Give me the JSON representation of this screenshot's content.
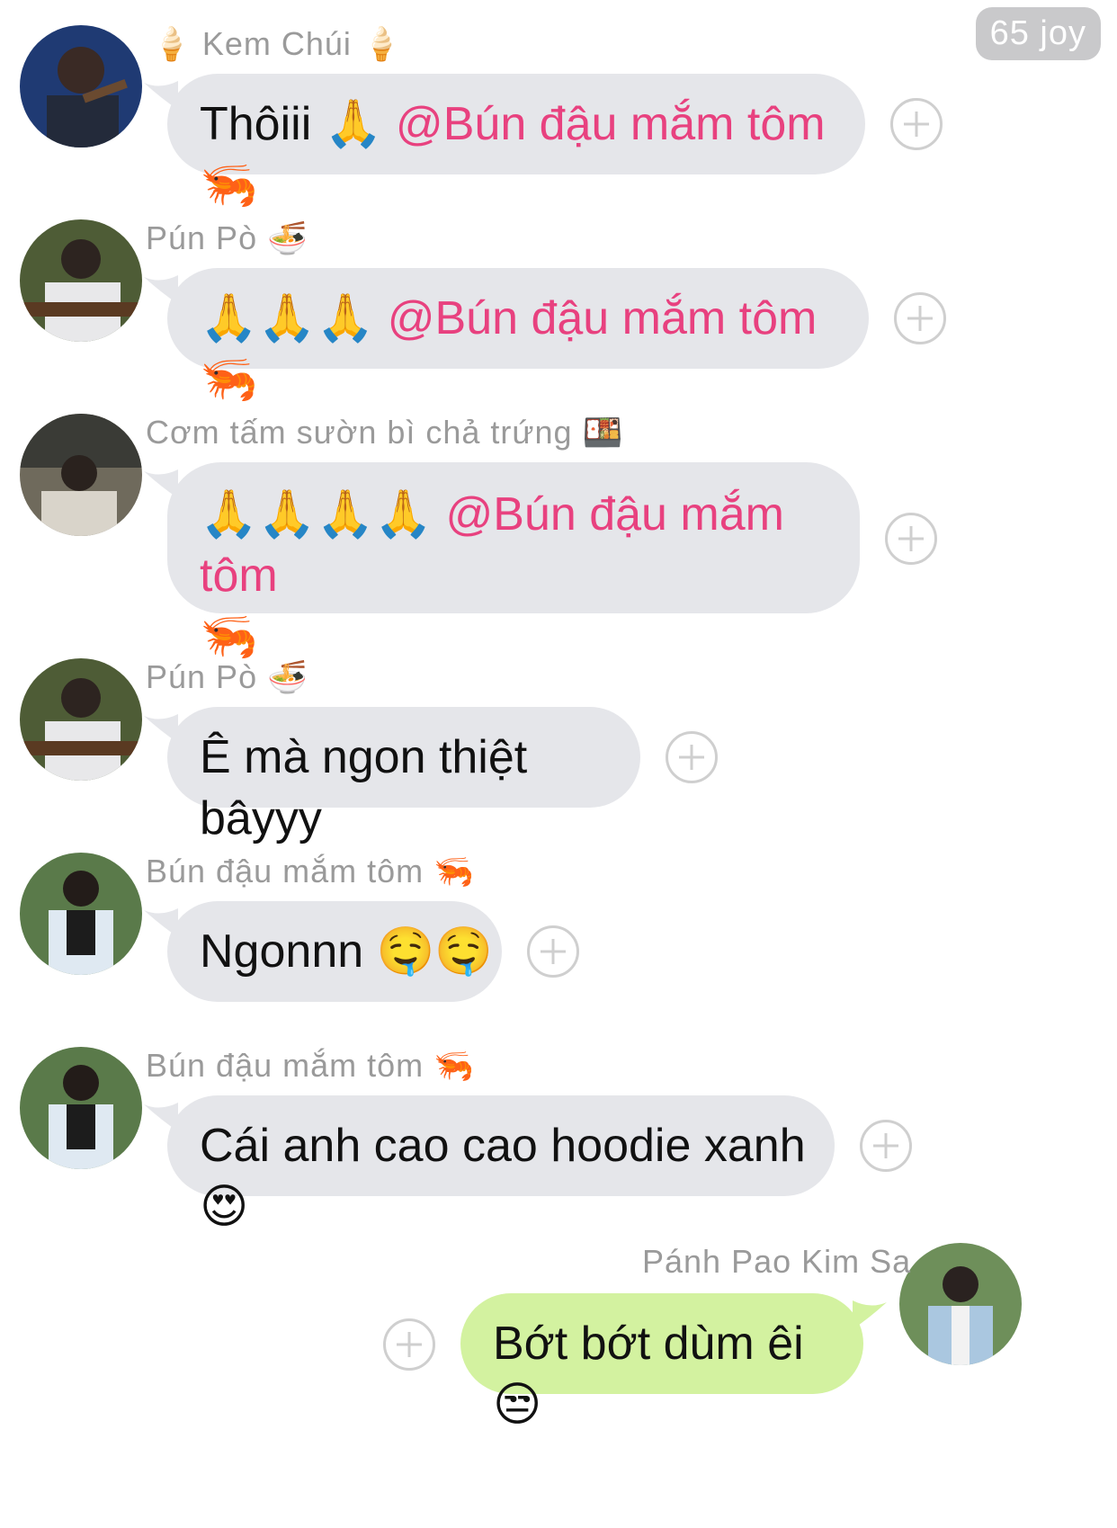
{
  "header": {
    "joy_badge": "65 joy"
  },
  "icons": {
    "add": "plus-circle-icon"
  },
  "messages": [
    {
      "sender": "Kem Chúi",
      "sender_emoji_left": "🍦",
      "sender_emoji_right": "🍦",
      "text": "Thôiii 🙏",
      "mention": "@Bún đậu mắm tôm 🦐"
    },
    {
      "sender": "Pún Pò",
      "sender_emoji_right": "🍜",
      "text": "🙏🙏🙏",
      "mention": "@Bún đậu mắm tôm 🦐"
    },
    {
      "sender": "Cơm tấm sườn bì chả trứng",
      "sender_emoji_right": "🍱",
      "text": "🙏🙏🙏🙏",
      "mention": "@Bún đậu mắm tôm",
      "mention_tail": "🦐"
    },
    {
      "sender": "Pún Pò",
      "sender_emoji_right": "🍜",
      "text": "Ê mà ngon thiệt bâyyy"
    },
    {
      "sender": "Bún đậu mắm tôm",
      "sender_emoji_right": "🦐",
      "text": "Ngonnn 🤤🤤"
    },
    {
      "sender": "Bún đậu mắm tôm",
      "sender_emoji_right": "🦐",
      "text": "Cái anh cao cao hoodie xanh 😍"
    },
    {
      "sender": "Pánh Pao Kim Sa",
      "text": "Bớt bớt dùm êi 😒",
      "own": true
    }
  ],
  "colors": {
    "incoming_bubble": "#e5e6ea",
    "outgoing_bubble": "#d3f2a0",
    "mention": "#e8417f",
    "name_text": "#9a9a9a"
  }
}
